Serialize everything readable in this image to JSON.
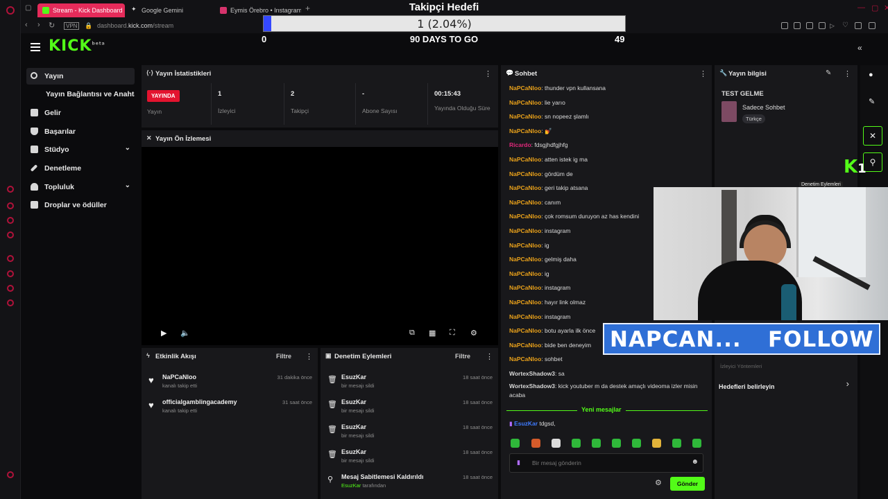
{
  "browser": {
    "tabs": [
      {
        "label": "Stream - Kick Dashboard",
        "active": true
      },
      {
        "label": "Google Gemini",
        "active": false
      },
      {
        "label": "Eymis Örebro • Instagram",
        "active": false
      }
    ],
    "new_tab_glyph": "+",
    "url_prefix": "dashboard.",
    "url_domain": "kick.com",
    "url_path": "/stream"
  },
  "goal_overlay": {
    "title": "Takipçi Hedefi",
    "progress_text": "1 (2.04%)",
    "progress_fraction": 0.0204,
    "start": "0",
    "days_to_go": "90 DAYS TO GO",
    "target": "49"
  },
  "header": {
    "logo": "KICK",
    "logo_superscript": "beta"
  },
  "sidebar": {
    "items": [
      {
        "label": "Yayın",
        "icon": "broadcast-icon",
        "active": true
      },
      {
        "label": "Yayın Bağlantısı ve Anahtarı",
        "icon": "",
        "active": false
      },
      {
        "label": "Gelir",
        "icon": "chart-icon",
        "active": false
      },
      {
        "label": "Başarılar",
        "icon": "trophy-icon",
        "active": false
      },
      {
        "label": "Stüdyo",
        "icon": "studio-icon",
        "active": false,
        "chevron": true
      },
      {
        "label": "Denetleme",
        "icon": "wrench-icon",
        "active": false
      },
      {
        "label": "Topluluk",
        "icon": "community-icon",
        "active": false,
        "chevron": true
      },
      {
        "label": "Droplar ve ödüller",
        "icon": "gift-icon",
        "active": false
      }
    ]
  },
  "stats_panel": {
    "title": "Yayın İstatistikleri",
    "live_badge": "YAYINDA",
    "live_label": "Yayın",
    "items": [
      {
        "value": "1",
        "label": "İzleyici"
      },
      {
        "value": "2",
        "label": "Takipçi"
      },
      {
        "value": "-",
        "label": "Abone Sayısı"
      },
      {
        "value": "00:15:43",
        "label": "Yayında Olduğu Süre"
      }
    ]
  },
  "preview_panel": {
    "title": "Yayın Ön İzlemesi"
  },
  "activity_panel": {
    "title": "Etkinlik Akışı",
    "filter": "Filtre",
    "rows": [
      {
        "name": "NaPCaNloo",
        "sub": "kanalı takip etti",
        "time": "31 dakika önce"
      },
      {
        "name": "officialgamblingacademy",
        "sub": "kanalı takip etti",
        "time": "31 saat önce"
      }
    ]
  },
  "mod_panel": {
    "title": "Denetim Eylemleri",
    "filter": "Filtre",
    "rows": [
      {
        "name": "EsuzKar",
        "sub": "bir mesajı sildi",
        "time": "18 saat önce"
      },
      {
        "name": "EsuzKar",
        "sub": "bir mesajı sildi",
        "time": "18 saat önce"
      },
      {
        "name": "EsuzKar",
        "sub": "bir mesajı sildi",
        "time": "18 saat önce"
      },
      {
        "name": "EsuzKar",
        "sub": "bir mesajı sildi",
        "time": "18 saat önce"
      },
      {
        "name": "Mesaj Sabitlemesi Kaldırıldı",
        "sub_user": "EsuzKar",
        "sub": "tarafından",
        "time": "18 saat önce"
      }
    ]
  },
  "chat": {
    "title": "Sohbet",
    "messages": [
      {
        "user": "NaPCaNloo",
        "text": "thunder vpn kullansana",
        "color": "#e9a11a"
      },
      {
        "user": "NaPCaNloo",
        "text": "lie yarıo",
        "color": "#e9a11a"
      },
      {
        "user": "NaPCaNloo",
        "text": "sn nopeez şlamlı",
        "color": "#e9a11a"
      },
      {
        "user": "NaPCaNloo",
        "text": "💅",
        "color": "#e9a11a"
      },
      {
        "user": "Ricardo",
        "text": "fdsgjhdfgjhfg",
        "color": "#e0287a"
      },
      {
        "user": "NaPCaNloo",
        "text": "atten istek ig ma",
        "color": "#e9a11a"
      },
      {
        "user": "NaPCaNloo",
        "text": "gördüm de",
        "color": "#e9a11a"
      },
      {
        "user": "NaPCaNloo",
        "text": "geri takip atsana",
        "color": "#e9a11a"
      },
      {
        "user": "NaPCaNloo",
        "text": "canım",
        "color": "#e9a11a"
      },
      {
        "user": "NaPCaNloo",
        "text": "çok romsum duruyon az has kendini",
        "color": "#e9a11a"
      },
      {
        "user": "NaPCaNloo",
        "text": "instagram",
        "color": "#e9a11a"
      },
      {
        "user": "NaPCaNloo",
        "text": "ig",
        "color": "#e9a11a"
      },
      {
        "user": "NaPCaNloo",
        "text": "gelmiş daha",
        "color": "#e9a11a"
      },
      {
        "user": "NaPCaNloo",
        "text": "ig",
        "color": "#e9a11a"
      },
      {
        "user": "NaPCaNloo",
        "text": "instagram",
        "color": "#e9a11a"
      },
      {
        "user": "NaPCaNloo",
        "text": "hayır link olmaz",
        "color": "#e9a11a"
      },
      {
        "user": "NaPCaNloo",
        "text": "instagram",
        "color": "#e9a11a"
      },
      {
        "user": "NaPCaNloo",
        "text": "botu ayarla ilk önce",
        "color": "#e9a11a"
      },
      {
        "user": "NaPCaNloo",
        "text": "bide ben deneyim",
        "color": "#e9a11a"
      },
      {
        "user": "NaPCaNloo",
        "text": "sohbet",
        "color": "#e9a11a"
      },
      {
        "user": "WortexShadow3",
        "text": "sa",
        "color": "#d8d8d8"
      },
      {
        "user": "WortexShadow3",
        "text": "kick youtuber m da destek amaçlı videoma izler misin acaba",
        "color": "#d8d8d8"
      }
    ],
    "new_messages_label": "Yeni mesajlar",
    "last_message": {
      "user": "EsuzKar",
      "text": "tdgsd,"
    },
    "input_placeholder": "Bir mesaj gönderin",
    "send_label": "Gönder"
  },
  "info_panel": {
    "title": "Yayın bilgisi",
    "stream_title": "TEST GELME",
    "category": "Sadece Sohbet",
    "language_tag": "Türkçe",
    "viewer_tag": "İzleyici Yöntemleri",
    "goals_link": "Hedefleri belirleyin"
  },
  "webcam_overlay": {
    "follow_name": "NAPCAN...",
    "follow_cta": "FOLLOW",
    "kick_badge": "K",
    "kick_badge_count": "1",
    "tooltip": "Denetim Eylemleri"
  },
  "colors": {
    "kick_green": "#53fc18",
    "live_red": "#e3132f",
    "goal_blue": "#3448ff",
    "follow_blue": "#2f6fd6",
    "panel_bg": "#18181b"
  }
}
